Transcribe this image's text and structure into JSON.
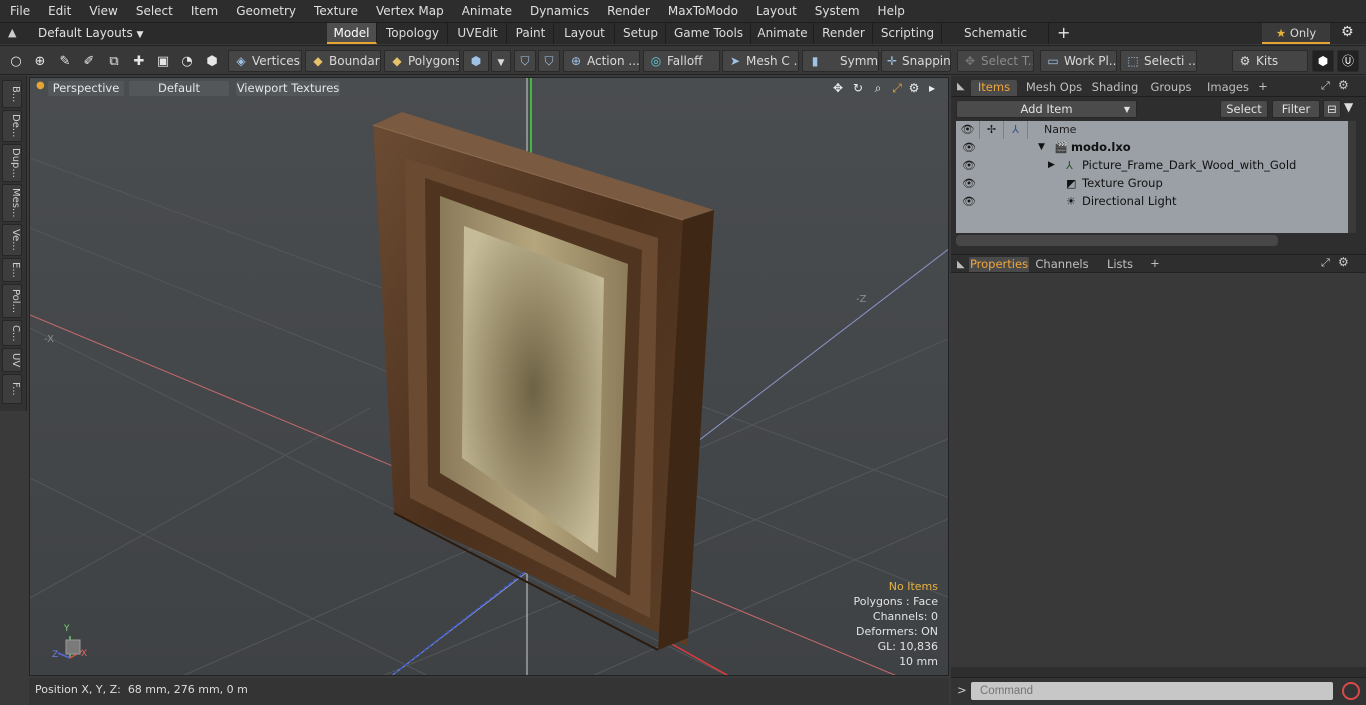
{
  "menubar": [
    "File",
    "Edit",
    "View",
    "Select",
    "Item",
    "Geometry",
    "Texture",
    "Vertex Map",
    "Animate",
    "Dynamics",
    "Render",
    "MaxToModo",
    "Layout",
    "System",
    "Help"
  ],
  "tabbar": {
    "layout_dropdown": "Default Layouts",
    "tabs": [
      "Model",
      "Topology",
      "UVEdit",
      "Paint",
      "Layout",
      "Setup",
      "Game Tools",
      "Animate",
      "Render",
      "Scripting",
      "Schematic Fusion"
    ],
    "active_tab": "Model",
    "add_tab": "+",
    "only_label": "Only"
  },
  "toolbar": {
    "vertices": "Vertices",
    "boundary": "Boundary",
    "polygons": "Polygons",
    "action": "Action",
    "action_more": "...",
    "falloff": "Falloff",
    "mesh": "Mesh C ...",
    "symm": "Symm ...",
    "snapping": "Snapping",
    "select_t": "Select T...",
    "work_pl": "Work Pl...",
    "selecti": "Selecti ...",
    "kits": "Kits"
  },
  "leftstrip": [
    "B...",
    "De...",
    "Dup...",
    "Mes...",
    "Ve...",
    "E...",
    "Pol...",
    "C...",
    "UV",
    "F..."
  ],
  "viewport": {
    "view": "Perspective",
    "shading": "Default",
    "textures": "Viewport Textures",
    "stats": {
      "selection": "No Items",
      "polygons": "Polygons : Face",
      "channels": "Channels: 0",
      "deformers": "Deformers: ON",
      "gl": "GL: 10,836",
      "unit": "10 mm"
    },
    "axis_labels": {
      "x": "-X",
      "z": "-Z"
    },
    "gizmo": {
      "x": "X",
      "y": "Y",
      "z": "Z"
    }
  },
  "statusbar": {
    "position_label": "Position X, Y, Z:",
    "position_value": "68 mm, 276 mm, 0 m"
  },
  "items_panel": {
    "tabs": [
      "Items",
      "Mesh Ops",
      "Shading",
      "Groups",
      "Images"
    ],
    "active_tab": "Items",
    "add_tab": "+",
    "add_item": "Add Item",
    "select": "Select",
    "filter": "Filter",
    "column_name": "Name",
    "rows": [
      {
        "label": "modo.lxo",
        "indent": 0
      },
      {
        "label": "Picture_Frame_Dark_Wood_with_Gold",
        "indent": 1
      },
      {
        "label": "Texture Group",
        "indent": 1
      },
      {
        "label": "Directional Light",
        "indent": 1
      }
    ]
  },
  "properties_panel": {
    "tabs": [
      "Properties",
      "Channels",
      "Lists"
    ],
    "active_tab": "Properties",
    "add_tab": "+"
  },
  "command": {
    "prompt": ">",
    "placeholder": "Command"
  },
  "colors": {
    "accent": "#e6a532",
    "viewport_bg": "#46494c",
    "frame_wood": "#5a3820",
    "canvas": "#a89c7a"
  }
}
